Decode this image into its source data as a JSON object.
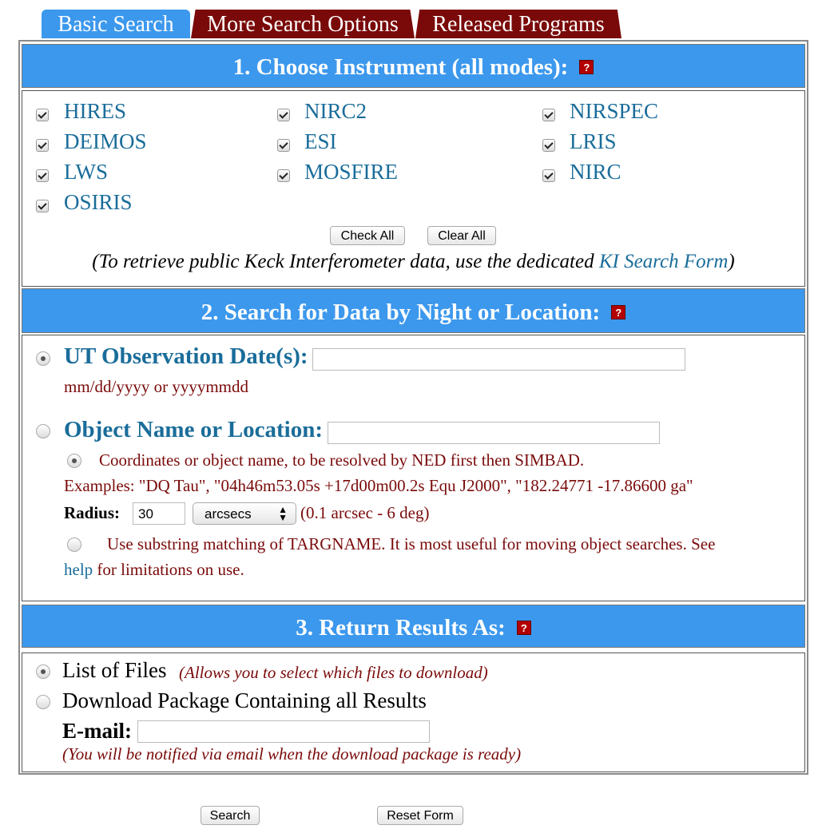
{
  "tabs": [
    "Basic Search",
    "More Search Options",
    "Released Programs"
  ],
  "section1": {
    "title": "1. Choose Instrument (all modes):",
    "help": "?",
    "instruments": [
      "HIRES",
      "NIRC2",
      "NIRSPEC",
      "DEIMOS",
      "ESI",
      "LRIS",
      "LWS",
      "MOSFIRE",
      "NIRC",
      "OSIRIS"
    ],
    "check_all": "Check All",
    "clear_all": "Clear All",
    "ki_note_prefix": "(To retrieve public Keck Interferometer data, use the dedicated ",
    "ki_link": "KI Search Form",
    "ki_note_suffix": ")"
  },
  "section2": {
    "title": "2. Search for Data by Night or Location:",
    "help": "?",
    "ut_label": "UT Observation Date(s):",
    "ut_value": "",
    "ut_hint": "mm/dd/yyyy or yyyymmdd",
    "obj_label": "Object Name or Location:",
    "obj_value": "",
    "resolve_text": "Coordinates or object name, to be resolved by NED first then SIMBAD.",
    "examples": "Examples: \"DQ Tau\", \"04h46m53.05s +17d00m00.2s Equ J2000\", \"182.24771 -17.86600 ga\"",
    "radius_label": "Radius:",
    "radius_value": "30",
    "radius_unit": "arcsecs",
    "radius_range": "(0.1 arcsec - 6 deg)",
    "substr_text": "Use substring matching of TARGNAME. It is most useful for moving object searches. See",
    "help_link": "help",
    "substr_suffix": " for limitations on use."
  },
  "section3": {
    "title": "3. Return Results As:",
    "help": "?",
    "list_files": "List of Files",
    "list_files_note": "(Allows you to select which files to download)",
    "download_pkg": "Download Package Containing all Results",
    "email_label": "E-mail:",
    "email_value": "",
    "email_note": "(You will be notified via email when the download package is ready)"
  },
  "actions": {
    "search": "Search",
    "reset": "Reset Form"
  },
  "colors": {
    "header_blue": "#3c98ed",
    "tab_maroon": "#7a0a0a",
    "link_blue": "#1a6d9a"
  }
}
